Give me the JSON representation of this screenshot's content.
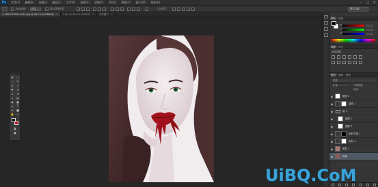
{
  "app": {
    "logo": "Ps"
  },
  "menu": [
    "文件(F)",
    "编辑(E)",
    "图像(I)",
    "图层(L)",
    "文字(Y)",
    "选择(S)",
    "滤镜(T)",
    "3D(D)",
    "视图(V)",
    "窗口(W)",
    "帮助(H)"
  ],
  "options_bar": {
    "auto_select": "自动选择:",
    "target": "图层",
    "transform": "显示变换控件",
    "workspace": "基本功能"
  },
  "tabs": [
    {
      "label": "1-1601021E413434.jpg @ 66.7% (RGB/8#)",
      "active": true
    },
    {
      "label": "1.jpg @ 66.7% (RGB/8)",
      "active": false
    },
    {
      "label": "未标题-1",
      "active": false
    }
  ],
  "panels": {
    "color_tabs": [
      "颜色",
      "色板"
    ],
    "color_sliders": [
      "R",
      "G",
      "B"
    ],
    "adjust_tabs": [
      "调整",
      "样式"
    ],
    "adjust_title": "添加调整",
    "layers_tabs": [
      "图层",
      "通道",
      "路径"
    ],
    "layers_kind": "类型",
    "layers_mode": "正常",
    "layers_opacity": "不透明度:",
    "layers_fill": "填充:",
    "layers": [
      {
        "name": "图层 2",
        "type": "normal"
      },
      {
        "name": "曲线 1",
        "type": "adjust"
      },
      {
        "name": "组 1",
        "type": "group"
      },
      {
        "name": "图层 1",
        "type": "normal"
      },
      {
        "name": "图层 3",
        "type": "normal"
      },
      {
        "name": "色彩平衡 1",
        "type": "adjust"
      },
      {
        "name": "色阶 1",
        "type": "adjust"
      },
      {
        "name": "图层 4",
        "type": "normal"
      },
      {
        "name": "背景",
        "type": "photo"
      }
    ]
  },
  "colors": {
    "foreground": "#000000",
    "background": "#b8111b",
    "accent": "#3aa3d8"
  },
  "watermark": "UiBQ.CoM"
}
